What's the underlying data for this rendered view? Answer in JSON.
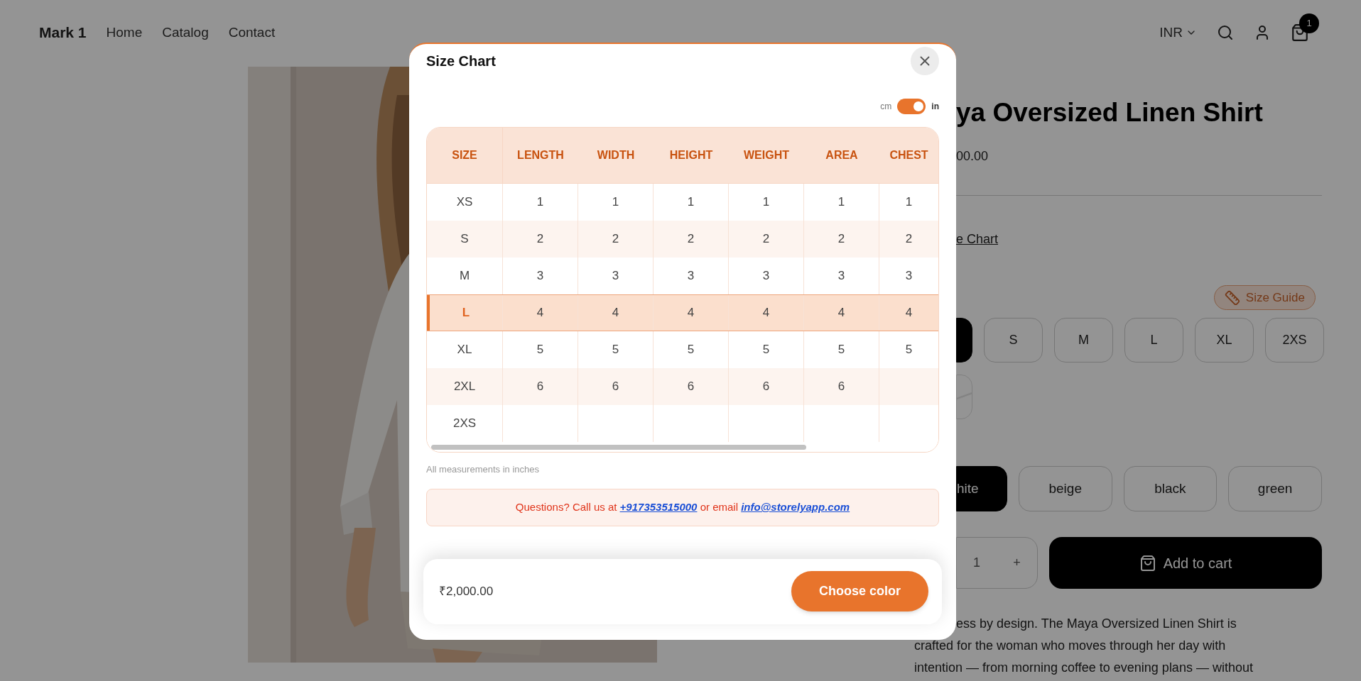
{
  "header": {
    "logo": "Mark 1",
    "nav": [
      "Home",
      "Catalog",
      "Contact"
    ],
    "currency": "INR",
    "cart_count": "1"
  },
  "product": {
    "title": "ya Oversized Linen Shirt",
    "price": "00.00",
    "size_chart_link": "e Chart",
    "size_guide": "Size Guide",
    "sizes": [
      {
        "selected": true,
        "disabled": false
      },
      {
        "label": "S",
        "selected": false,
        "disabled": false
      },
      {
        "label": "M",
        "selected": false,
        "disabled": false
      },
      {
        "label": "L",
        "selected": false,
        "disabled": false
      },
      {
        "label": "XL",
        "selected": false,
        "disabled": false
      },
      {
        "label": "2XS",
        "selected": false,
        "disabled": false
      },
      {
        "selected": false,
        "disabled": true
      }
    ],
    "colors": [
      {
        "label": "hite",
        "selected": true
      },
      {
        "label": "beige",
        "selected": false
      },
      {
        "label": "black",
        "selected": false
      },
      {
        "label": "green",
        "selected": false
      }
    ],
    "quantity": "1",
    "quantity_plus": "+",
    "add_to_cart": "Add to cart",
    "description_lines": [
      "ess by design. The Maya Oversized Linen Shirt is",
      "crafted for the woman who moves through her day with",
      "intention — from morning coffee to evening plans — without"
    ]
  },
  "modal": {
    "title": "Size Chart",
    "unit_toggle": {
      "left": "cm",
      "right": "in",
      "on": true
    },
    "table": {
      "columns": [
        "SIZE",
        "LENGTH",
        "WIDTH",
        "HEIGHT",
        "WEIGHT",
        "AREA",
        "CHEST"
      ],
      "rows": [
        {
          "cells": [
            "XS",
            "1",
            "1",
            "1",
            "1",
            "1",
            "1"
          ],
          "selected": false
        },
        {
          "cells": [
            "S",
            "2",
            "2",
            "2",
            "2",
            "2",
            "2"
          ],
          "selected": false
        },
        {
          "cells": [
            "M",
            "3",
            "3",
            "3",
            "3",
            "3",
            "3"
          ],
          "selected": false
        },
        {
          "cells": [
            "L",
            "4",
            "4",
            "4",
            "4",
            "4",
            "4"
          ],
          "selected": true
        },
        {
          "cells": [
            "XL",
            "5",
            "5",
            "5",
            "5",
            "5",
            "5"
          ],
          "selected": false
        },
        {
          "cells": [
            "2XL",
            "6",
            "6",
            "6",
            "6",
            "6",
            null
          ],
          "selected": false
        },
        {
          "cells": [
            "2XS",
            null,
            null,
            null,
            null,
            null,
            null
          ],
          "selected": false
        }
      ]
    },
    "note": "All measurements in inches",
    "contact": {
      "prefix": "Questions? Call us at",
      "phone": "+917353515000",
      "middle": "or email",
      "email": "info@storelyapp.com"
    },
    "footer": {
      "price": "₹2,000.00",
      "button": "Choose color"
    }
  }
}
